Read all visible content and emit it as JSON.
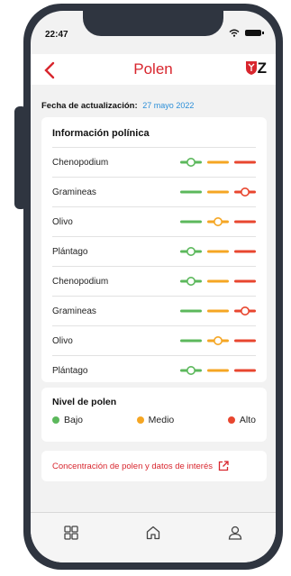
{
  "status_bar": {
    "time": "22:47"
  },
  "header": {
    "title": "Polen",
    "logo_letter": "Z"
  },
  "update": {
    "label": "Fecha de actualización:",
    "date": "27 mayo 2022"
  },
  "info": {
    "title": "Información polínica",
    "rows": [
      {
        "name": "Chenopodium",
        "level": "low"
      },
      {
        "name": "Gramineas",
        "level": "high"
      },
      {
        "name": "Olivo",
        "level": "medium"
      },
      {
        "name": "Plántago",
        "level": "low"
      },
      {
        "name": "Chenopodium",
        "level": "low"
      },
      {
        "name": "Gramineas",
        "level": "high"
      },
      {
        "name": "Olivo",
        "level": "medium"
      },
      {
        "name": "Plántago",
        "level": "low"
      }
    ]
  },
  "legend": {
    "title": "Nivel de polen",
    "items": [
      {
        "label": "Bajo",
        "color": "#5cb85c"
      },
      {
        "label": "Medio",
        "color": "#f5a623"
      },
      {
        "label": "Alto",
        "color": "#e8462f"
      }
    ]
  },
  "link": {
    "text": "Concentración de polen y datos de interés"
  },
  "colors": {
    "accent": "#d8262e",
    "low": "#5cb85c",
    "medium": "#f5a623",
    "high": "#e8462f",
    "date": "#2c8fd8"
  },
  "tabbar": {
    "icons": [
      "grid-icon",
      "home-icon",
      "user-icon"
    ]
  }
}
